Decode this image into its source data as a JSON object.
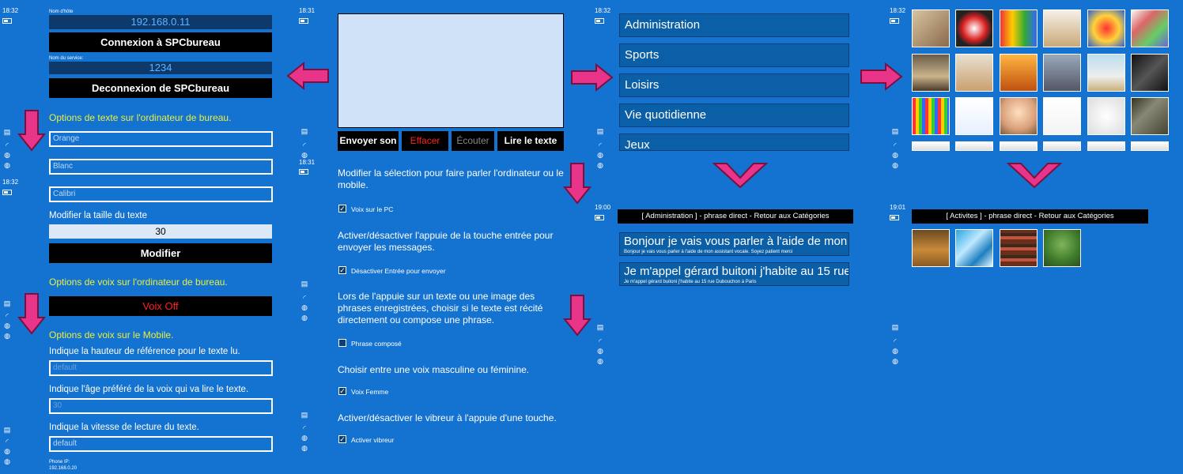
{
  "status": {
    "t1": "18:32",
    "t2": "18:31",
    "t3": "18:31",
    "t4": "18:32",
    "t5": "18:32",
    "t6": "18:32",
    "t7": "19:00",
    "t8": "19:01"
  },
  "settings": {
    "host_label": "Nom d'hôte",
    "host_value": "192.168.0.11",
    "connect_btn": "Connexion à SPCbureau",
    "service_label": "Nom du service:",
    "service_value": "1234",
    "disconnect_btn": "Deconnexion de SPCbureau",
    "text_options_title": "Options de texte sur l'ordinateur de bureau.",
    "text_color": "Orange",
    "bg_color": "Blanc",
    "font": "Calibri",
    "size_label": "Modifier la taille du texte",
    "size_value": "30",
    "modify_btn": "Modifier",
    "voice_pc_title": "Options de voix sur l'ordinateur de bureau.",
    "voice_off_btn": "Voix Off",
    "voice_mobile_title": "Options de voix sur le Mobile.",
    "pitch_label": "Indique la hauteur de référence pour le texte lu.",
    "pitch_value": "default",
    "age_label": "Indique l'âge préféré de la voix qui va lire le texte.",
    "age_value": "30",
    "speed_label": "Indique la vitesse de lecture du texte.",
    "speed_value": "default",
    "phone_ip_label": "Phone IP:",
    "phone_ip_value": "192.168.0.20"
  },
  "composer": {
    "send_btn": "Envoyer son",
    "clear_btn": "Effacer",
    "listen_btn": "Écouter",
    "read_btn": "Lire le texte",
    "p1": "Modifier la sélection pour faire parler l'ordinateur ou le mobile.",
    "c1": "Voix sur le PC",
    "p2": "Activer/désactiver l'appuie de la touche entrée pour envoyer les messages.",
    "c2": "Désactiver Entrée pour envoyer",
    "p3": "Lors de l'appuie sur un texte ou une image des phrases enregistrées, choisir si le texte est récité directement ou compose une phrase.",
    "c3": "Phrase composé",
    "p4": "Choisir entre une voix masculine ou féminine.",
    "c4": "Voix Femme",
    "p5": "Activer/désactiver le vibreur à l'appuie d'une touche.",
    "c5": "Activer vibreur"
  },
  "categories": {
    "items": [
      "Administration",
      "Sports",
      "Loisirs",
      "Vie quotidienne",
      "Jeux"
    ],
    "phrase_header": "[ Administration ] - phrase direct - Retour aux Catégories",
    "phrases": [
      {
        "title": "Bonjour je vais vous parler à l'aide de mon",
        "sub": "Bonjour je vais vous parler à l'aide de mon assistant vocale. Soyez patient merci"
      },
      {
        "title": "Je m'appel gérard buitoni j'habite au 15 rue",
        "sub": "Je m'appel gérard buitoni j'habite au 15 rue Dubouchon à Paris"
      }
    ]
  },
  "images": {
    "activity_header": "[ Activites ] - phrase direct - Retour aux Catégories"
  },
  "colors": {
    "background": "#1472d0",
    "accent_arrow": "#e8358a",
    "yellow": "#e9f03c",
    "red": "#ff2020"
  }
}
